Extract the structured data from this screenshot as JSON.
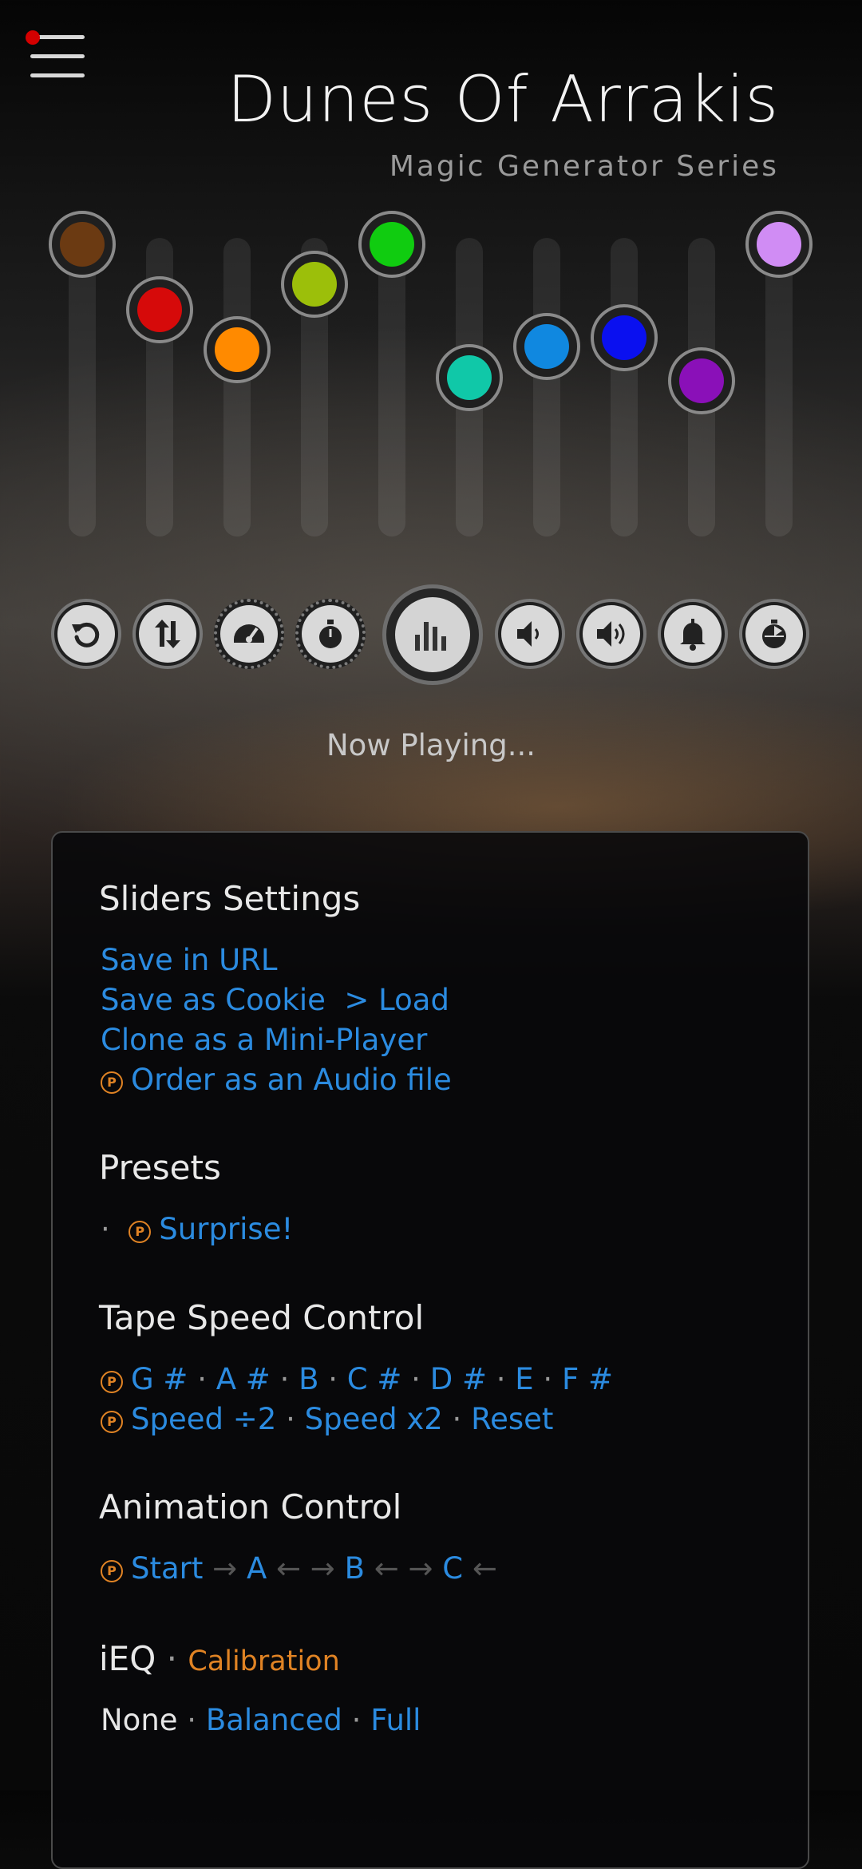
{
  "header": {
    "title": "Dunes Of Arrakis",
    "subtitle": "Magic Generator Series"
  },
  "sliders": [
    {
      "name": "slider-1",
      "color": "#6b3a12",
      "level": 1.0
    },
    {
      "name": "slider-2",
      "color": "#d60a0a",
      "level": 0.77
    },
    {
      "name": "slider-3",
      "color": "#ff8a00",
      "level": 0.63
    },
    {
      "name": "slider-4",
      "color": "#9cbf0a",
      "level": 0.86
    },
    {
      "name": "slider-5",
      "color": "#10cc10",
      "level": 1.0
    },
    {
      "name": "slider-6",
      "color": "#10c8a8",
      "level": 0.53
    },
    {
      "name": "slider-7",
      "color": "#1088e0",
      "level": 0.64
    },
    {
      "name": "slider-8",
      "color": "#0a10f0",
      "level": 0.67
    },
    {
      "name": "slider-9",
      "color": "#8a10b8",
      "level": 0.52
    },
    {
      "name": "slider-10",
      "color": "#d08cf4",
      "level": 1.0
    }
  ],
  "controls": [
    "reset-icon",
    "sliders-shuffle-icon",
    "speedometer-icon",
    "stopwatch-icon",
    "equalizer-icon",
    "volume-low-icon",
    "volume-high-icon",
    "bell-icon",
    "timer-icon"
  ],
  "status": "Now Playing...",
  "panel": {
    "sliders_settings": {
      "heading": "Sliders Settings",
      "save_url": "Save in URL",
      "save_cookie": "Save as Cookie",
      "load": "> Load",
      "clone": "Clone as a Mini-Player",
      "order": "Order as an Audio file"
    },
    "presets": {
      "heading": "Presets",
      "bullet": "·",
      "surprise": "Surprise!"
    },
    "tape": {
      "heading": "Tape Speed Control",
      "notes": [
        "G #",
        "A #",
        "B",
        "C #",
        "D #",
        "E",
        "F #"
      ],
      "separator": "·",
      "speed_half": "Speed ÷2",
      "speed_double": "Speed x2",
      "reset": "Reset"
    },
    "animation": {
      "heading": "Animation Control",
      "start": "Start",
      "a": "A",
      "b": "B",
      "c": "C",
      "right_arrow": "→",
      "left_arrow": "←"
    },
    "ieq": {
      "heading": "iEQ",
      "separator": "·",
      "calibration": "Calibration",
      "none": "None",
      "balanced": "Balanced",
      "full": "Full"
    }
  },
  "premium_mark": "P"
}
